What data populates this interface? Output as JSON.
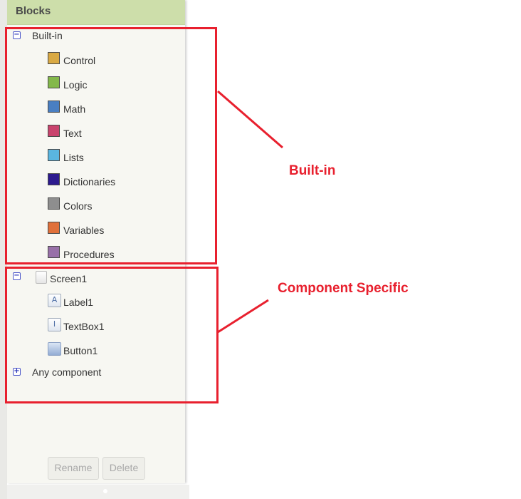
{
  "panel": {
    "title": "Blocks"
  },
  "builtin": {
    "label": "Built-in",
    "toggle": "−",
    "items": [
      {
        "label": "Control",
        "color": "#d9a943"
      },
      {
        "label": "Logic",
        "color": "#83b84a"
      },
      {
        "label": "Math",
        "color": "#4a7fc2"
      },
      {
        "label": "Text",
        "color": "#c9436d"
      },
      {
        "label": "Lists",
        "color": "#5ab5e0"
      },
      {
        "label": "Dictionaries",
        "color": "#2c1a8e"
      },
      {
        "label": "Colors",
        "color": "#8e8e8e"
      },
      {
        "label": "Variables",
        "color": "#e0703a"
      },
      {
        "label": "Procedures",
        "color": "#9870a8"
      }
    ]
  },
  "screen": {
    "label": "Screen1",
    "toggle": "−",
    "components": [
      {
        "label": "Label1",
        "icon": "label-icon",
        "glyph": "A"
      },
      {
        "label": "TextBox1",
        "icon": "textbox-icon",
        "glyph": "I"
      },
      {
        "label": "Button1",
        "icon": "button-icon",
        "glyph": ""
      }
    ]
  },
  "any_component": {
    "label": "Any component",
    "toggle": "+"
  },
  "buttons": {
    "rename": "Rename",
    "delete": "Delete"
  },
  "annotations": {
    "builtin_label": "Built-in",
    "component_label": "Component Specific",
    "color": "#e8202e"
  }
}
